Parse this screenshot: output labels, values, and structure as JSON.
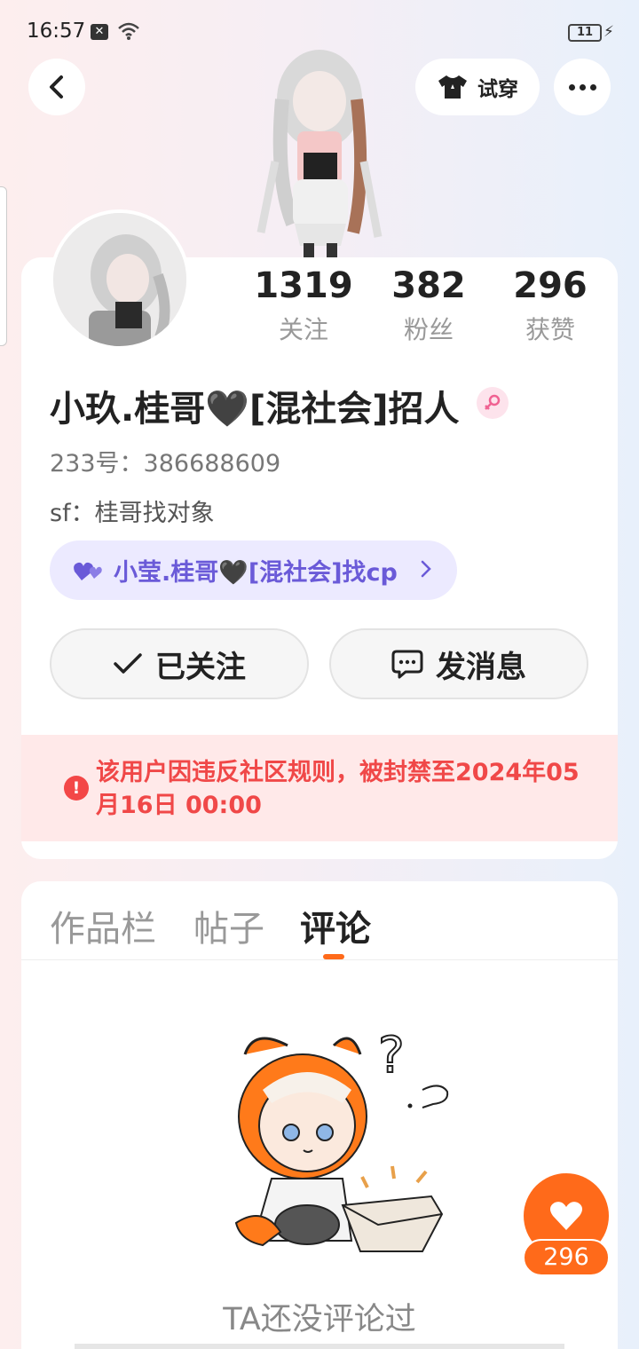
{
  "status_bar": {
    "time": "16:57",
    "battery": "11"
  },
  "header": {
    "try_on_label": "试穿"
  },
  "stats": [
    {
      "value": "1319",
      "label": "关注"
    },
    {
      "value": "382",
      "label": "粉丝"
    },
    {
      "value": "296",
      "label": "获赞"
    }
  ],
  "profile": {
    "nickname": "小玖.桂哥🖤[混社会]招人",
    "uid": "233号：386688609",
    "signature": "sf：桂哥找对象",
    "cp_label": "小莹.桂哥🖤[混社会]找cp"
  },
  "actions": {
    "follow_label": "已关注",
    "message_label": "发消息"
  },
  "ban_notice": "该用户因违反社区规则，被封禁至2024年05月16日 00:00",
  "tabs": [
    {
      "label": "作品栏"
    },
    {
      "label": "帖子"
    },
    {
      "label": "评论"
    }
  ],
  "active_tab": "评论",
  "empty_state": "TA还没评论过",
  "like": {
    "count": "296"
  },
  "colors": {
    "accent": "#ff6a1a",
    "ban": "#f04848",
    "cp": "#6a5ad8"
  },
  "icons": [
    "back-icon",
    "shirt-icon",
    "more-icon",
    "female-icon",
    "heart-pair-icon",
    "check-icon",
    "chat-icon",
    "warning-icon",
    "heart-icon"
  ]
}
